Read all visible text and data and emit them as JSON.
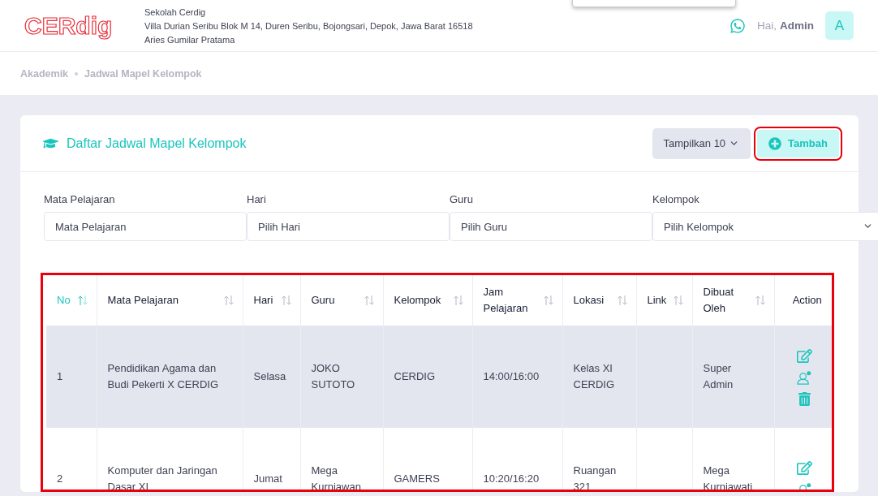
{
  "header": {
    "logo": "CERdig",
    "school_name": "Sekolah Cerdig",
    "address": "Villa Durian Seribu Blok M 14, Duren Seribu, Bojongsari, Depok, Jawa Barat 16518",
    "principal": "Aries Gumilar Pratama",
    "greeting": "Hai,",
    "user": "Admin",
    "avatar": "A"
  },
  "breadcrumb": [
    "Akademik",
    "Jadwal Mapel Kelompok"
  ],
  "card": {
    "title": "Daftar Jadwal Mapel Kelompok",
    "page_size": "Tampilkan 10",
    "add_button": {
      "label": "Tambah",
      "highlighted": true
    }
  },
  "filters": [
    {
      "label": "Mata Pelajaran",
      "placeholder": "Mata Pelajaran",
      "kind": "input"
    },
    {
      "label": "Hari",
      "placeholder": "Pilih Hari",
      "kind": "input"
    },
    {
      "label": "Guru",
      "placeholder": "Pilih Guru",
      "kind": "input"
    },
    {
      "label": "Kelompok",
      "placeholder": "Pilih Kelompok",
      "kind": "select"
    }
  ],
  "table": {
    "highlighted": true,
    "columns": [
      {
        "label": "No",
        "sortable": true,
        "sorted": true
      },
      {
        "label": "Mata Pelajaran",
        "sortable": true,
        "sorted": false
      },
      {
        "label": "Hari",
        "sortable": true,
        "sorted": false
      },
      {
        "label": "Guru",
        "sortable": true,
        "sorted": false
      },
      {
        "label": "Kelompok",
        "sortable": true,
        "sorted": false
      },
      {
        "label": "Jam Pelajaran",
        "sortable": true,
        "sorted": false
      },
      {
        "label": "Lokasi",
        "sortable": true,
        "sorted": false
      },
      {
        "label": "Link",
        "sortable": true,
        "sorted": false
      },
      {
        "label": "Dibuat Oleh",
        "sortable": true,
        "sorted": false
      },
      {
        "label": "Action",
        "sortable": false,
        "sorted": false
      }
    ],
    "rows": [
      {
        "selected": true,
        "cells": [
          "1",
          "Pendidikan Agama dan Budi Pekerti X CERDIG",
          "Selasa",
          "JOKO SUTOTO",
          "CERDIG",
          "14:00/16:00",
          "Kelas XI CERDIG",
          "",
          "Super Admin"
        ],
        "actions": [
          {
            "kind": "edit"
          },
          {
            "kind": "user-settings"
          },
          {
            "kind": "delete"
          }
        ]
      },
      {
        "selected": false,
        "cells": [
          "2",
          "Komputer dan Jaringan Dasar XI",
          "Jumat",
          "Mega Kurniawan",
          "GAMERS",
          "10:20/16:20",
          "Ruangan 321",
          "",
          "Mega Kurniawati"
        ],
        "actions": [
          {
            "kind": "edit"
          },
          {
            "kind": "user-settings"
          }
        ]
      }
    ]
  }
}
